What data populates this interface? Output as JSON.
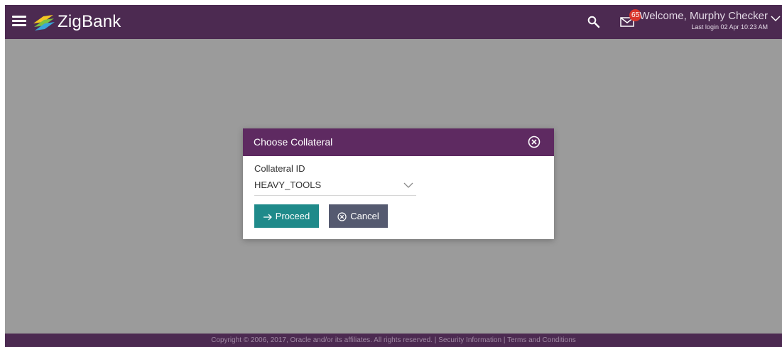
{
  "header": {
    "brand": "ZigBank",
    "notification_count": "65",
    "welcome_text": "Welcome, Murphy Checker",
    "last_login": "Last login 02 Apr 10:23 AM",
    "icons": [
      "menu-icon",
      "zigbank-logo-icon",
      "search-icon",
      "mail-icon",
      "chevron-down-icon"
    ]
  },
  "modal": {
    "title": "Choose Collateral",
    "field_label": "Collateral ID",
    "selected_value": "HEAVY_TOOLS",
    "proceed_label": "Proceed",
    "cancel_label": "Cancel",
    "icons": [
      "close-circle-icon",
      "chevron-down-icon",
      "arrow-right-icon",
      "cancel-circle-icon"
    ]
  },
  "footer": {
    "copyright": "Copyright © 2006, 2017, Oracle and/or its affiliates. All rights reserved.",
    "separator": "|",
    "security_link": "Security Information",
    "terms_link": "Terms and Conditions"
  },
  "colors": {
    "header_bg": "#4c2a51",
    "modal_header_bg": "#5e2a61",
    "overlay_bg": "#9b9b9b",
    "proceed_bg": "#1f8a8a",
    "cancel_bg": "#555a70",
    "badge_bg": "#d9352b"
  }
}
